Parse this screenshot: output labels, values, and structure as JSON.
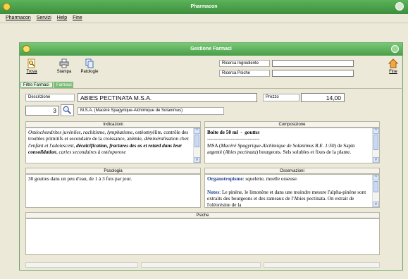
{
  "app": {
    "title": "Pharmacon",
    "menu": [
      "Pharmacon",
      "Servizi",
      "Help",
      "Fine"
    ]
  },
  "window": {
    "title": "Gestione Farmaci"
  },
  "toolbar": {
    "trova": "Trova",
    "stampa": "Stampa",
    "patologie": "Patologie",
    "fine": "Fine",
    "ricerca_ingrediente_label": "Ricerca Ingrediente",
    "ricerca_ingrediente_value": "",
    "ricerca_psiche_label": "Ricerca Psiche",
    "ricerca_psiche_value": ""
  },
  "tabs": [
    "Filtro Farmaci",
    "Farmaci"
  ],
  "record": {
    "descrizione_label": "Descrizione",
    "descrizione_value": "ABIES PECTINATA M.S.A.",
    "prezzo_label": "Prezzo",
    "prezzo_value": "14,00",
    "counter": "3",
    "subtitle": "M.S.A. (Macéré Spagyrique-Alchimique de Solanimus)"
  },
  "panels": {
    "indicazioni": {
      "label": "Indicazioni",
      "text": "Ostéochondrites juvéniles, rachitisme, lymphatisme, ostéomyélite, contrôle des troubles primitifs et secondaire de la croissance, anémie, déminéralisation chez l'enfant et l'adolescent, décalcification, fractures des os et retard dans leur consolidation, caries secondaires à ostéoporose"
    },
    "composizione": {
      "label": "Composizione",
      "line1": "Boite de 50 ml",
      "line1b": "gouttes",
      "separator": "-------------------------------",
      "text": "MSA (Macéré Spagyrique-Alchimique de Solanimus R.E. 1:50) de Sapin argenté (Abies pectinata) bourgeons. Sels solubles et fixes de la plante."
    },
    "posologia": {
      "label": "Posologia",
      "text": "30 gouttes dans un peu d'eau, de 1 à 3 fois par jour."
    },
    "osservazioni": {
      "label": "Osservazioni",
      "organo_label": "Organotropisme",
      "organo_text": ": squelette, moelle osseuse.",
      "notes_label": "Notes",
      "notes_text": ": Le pinène, le limonène et dans une moindre mesure l'alpha-pinène sont extraits des bourgeons et des rameaux de l'Abies pectinata. On extrait de l'oléorésine de la"
    },
    "psiche": {
      "label": "Psiche",
      "text": ""
    }
  },
  "colors": {
    "titlebar": "#4a9e48",
    "tab_active": "#e9f3e4",
    "tab_inactive": "#7fbf78",
    "organotropisme": "#1f3f8f"
  }
}
